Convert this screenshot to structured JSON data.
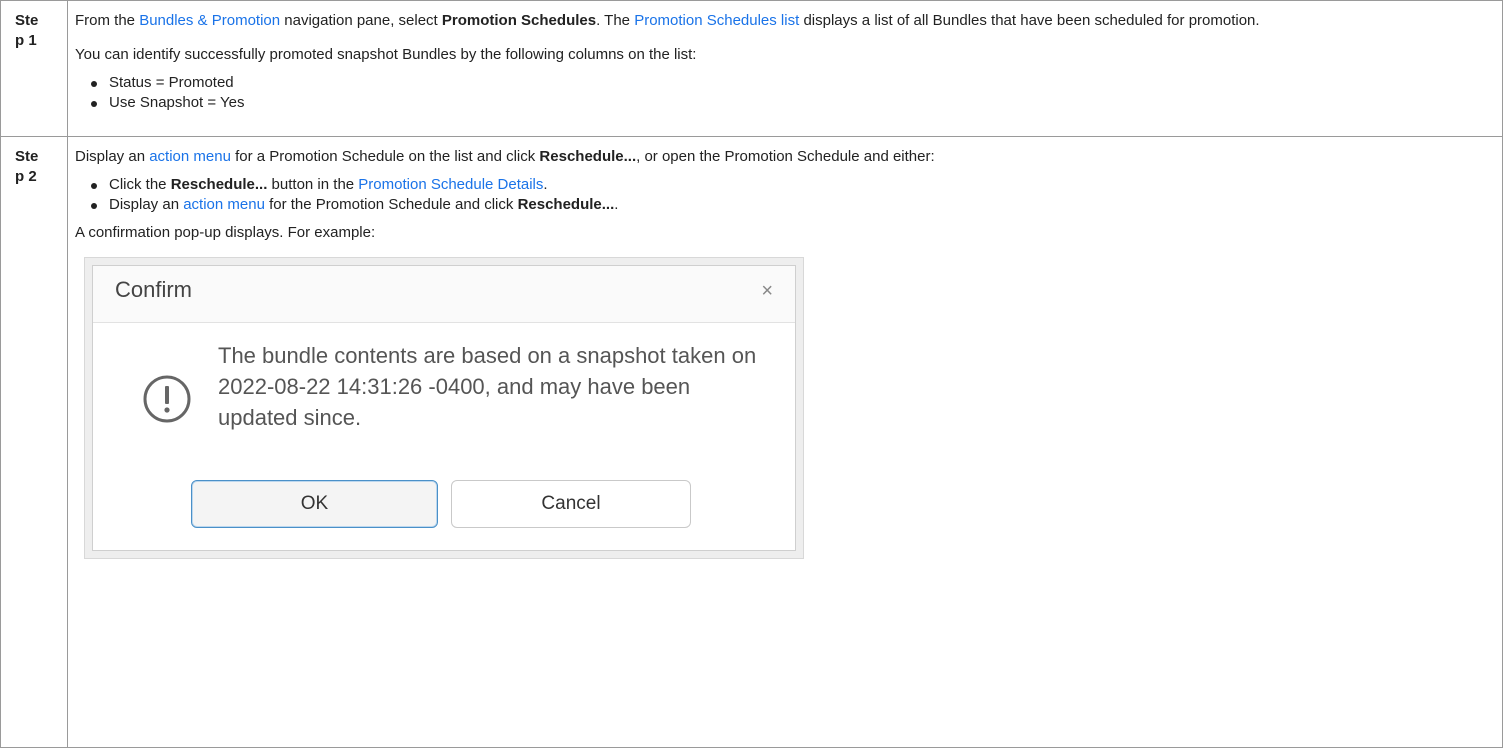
{
  "step1": {
    "label_part1": "Ste",
    "label_part2": "p 1",
    "p1_prefix": "From the ",
    "p1_link1": "Bundles & Promotion",
    "p1_middle": " navigation pane, select ",
    "p1_bold": "Promotion Schedules",
    "p1_after_bold": ". The ",
    "p1_link2": "Promotion Schedules list",
    "p1_suffix": " displays a list of all Bundles that have been scheduled for promotion.",
    "p2": "You can identify successfully promoted snapshot Bundles by the following columns on the list:",
    "bullets": [
      "Status = Promoted",
      "Use Snapshot = Yes"
    ]
  },
  "step2": {
    "label_part1": "Ste",
    "label_part2": "p 2",
    "p1_prefix": "Display an ",
    "p1_link": "action menu",
    "p1_middle": " for a Promotion Schedule on the list and click ",
    "p1_bold": "Reschedule...",
    "p1_suffix": ", or open the Promotion Schedule and either:",
    "bullet1_prefix": "Click the ",
    "bullet1_bold": "Reschedule...",
    "bullet1_middle": " button in the ",
    "bullet1_link": "Promotion Schedule Details",
    "bullet1_suffix": ".",
    "bullet2_prefix": "Display an ",
    "bullet2_link": "action menu",
    "bullet2_middle": " for the Promotion Schedule and click ",
    "bullet2_bold": "Reschedule...",
    "bullet2_suffix": ".",
    "p2": "A confirmation pop-up displays. For example:"
  },
  "dialog": {
    "title": "Confirm",
    "close_glyph": "×",
    "message": "The bundle contents are based on a snapshot taken on 2022-08-22 14:31:26 -0400, and may have been updated since.",
    "ok_label": "OK",
    "cancel_label": "Cancel",
    "icon": "exclamation-circle-icon"
  },
  "colors": {
    "link": "#1a73e8",
    "border": "#9a9a9a",
    "ok_border": "#4a90c8"
  }
}
